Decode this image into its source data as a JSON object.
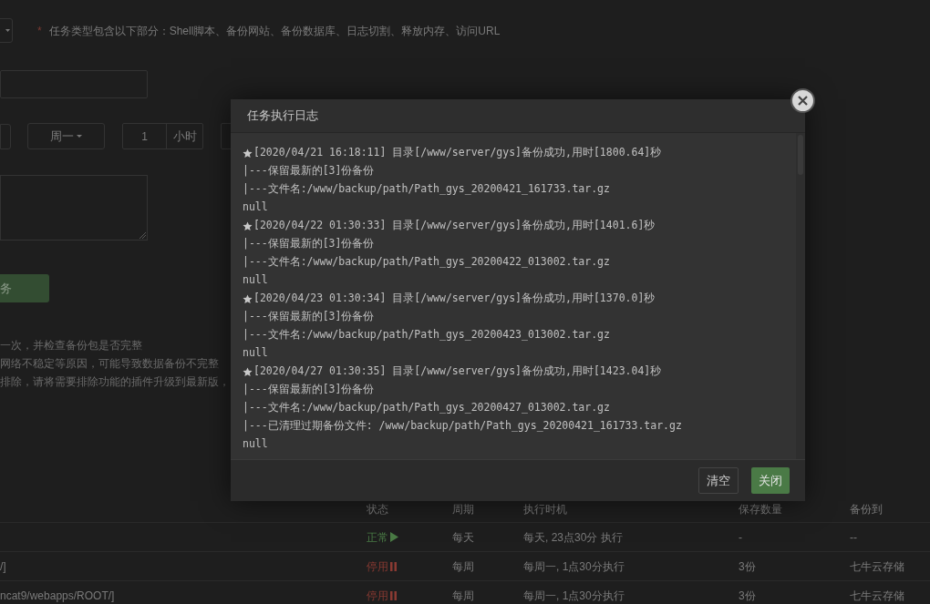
{
  "form": {
    "hint_mark": "*",
    "hint": "任务类型包含以下部分：Shell脚本、备份网站、备份数据库、日志切割、释放内存、访问URL",
    "week_select": "周一",
    "hour_value": "1",
    "hour_unit": "小时",
    "submit_button": "务",
    "notes": [
      "一次，并检查备份包是否完整",
      "网络不稳定等原因，可能导致数据备份不完整",
      "排除，请将需要排除功能的插件升级到最新版，"
    ]
  },
  "table": {
    "columns": [
      "状态",
      "周期",
      "执行时机",
      "保存数量",
      "备份到"
    ],
    "rows": [
      {
        "column_1": "",
        "status": {
          "text": "正常",
          "kind": "normal"
        },
        "cycle": "每天",
        "timing": "每天, 23点30分 执行",
        "keep": "-",
        "target": "--"
      },
      {
        "column_1": "/]",
        "status": {
          "text": "停用",
          "kind": "stopped"
        },
        "cycle": "每周",
        "timing": "每周一, 1点30分执行",
        "keep": "3份",
        "target": "七牛云存储"
      },
      {
        "column_1": "ncat9/webapps/ROOT/]",
        "status": {
          "text": "停用",
          "kind": "stopped"
        },
        "cycle": "每周",
        "timing": "每周一, 1点30分执行",
        "keep": "3份",
        "target": "七牛云存储"
      }
    ]
  },
  "dialog": {
    "title": "任务执行日志",
    "log_lines": [
      {
        "kind": "entry",
        "text": "[2020/04/21 16:18:11] 目录[/www/server/gys]备份成功,用时[1800.64]秒"
      },
      {
        "kind": "detail",
        "text": "|---保留最新的[3]份备份"
      },
      {
        "kind": "detail",
        "text": "|---文件名:/www/backup/path/Path_gys_20200421_161733.tar.gz"
      },
      {
        "kind": "detail",
        "text": "null"
      },
      {
        "kind": "entry",
        "text": "[2020/04/22 01:30:33] 目录[/www/server/gys]备份成功,用时[1401.6]秒"
      },
      {
        "kind": "detail",
        "text": "|---保留最新的[3]份备份"
      },
      {
        "kind": "detail",
        "text": "|---文件名:/www/backup/path/Path_gys_20200422_013002.tar.gz"
      },
      {
        "kind": "detail",
        "text": "null"
      },
      {
        "kind": "entry",
        "text": "[2020/04/23 01:30:34] 目录[/www/server/gys]备份成功,用时[1370.0]秒"
      },
      {
        "kind": "detail",
        "text": "|---保留最新的[3]份备份"
      },
      {
        "kind": "detail",
        "text": "|---文件名:/www/backup/path/Path_gys_20200423_013002.tar.gz"
      },
      {
        "kind": "detail",
        "text": "null"
      },
      {
        "kind": "entry",
        "text": "[2020/04/27 01:30:35] 目录[/www/server/gys]备份成功,用时[1423.04]秒"
      },
      {
        "kind": "detail",
        "text": "|---保留最新的[3]份备份"
      },
      {
        "kind": "detail",
        "text": "|---文件名:/www/backup/path/Path_gys_20200427_013002.tar.gz"
      },
      {
        "kind": "detail",
        "text": "|---已清理过期备份文件: /www/backup/path/Path_gys_20200421_161733.tar.gz"
      },
      {
        "kind": "detail",
        "text": "null"
      }
    ],
    "buttons": [
      {
        "label": "清空",
        "kind": "default"
      },
      {
        "label": "关闭",
        "kind": "primary"
      }
    ]
  }
}
